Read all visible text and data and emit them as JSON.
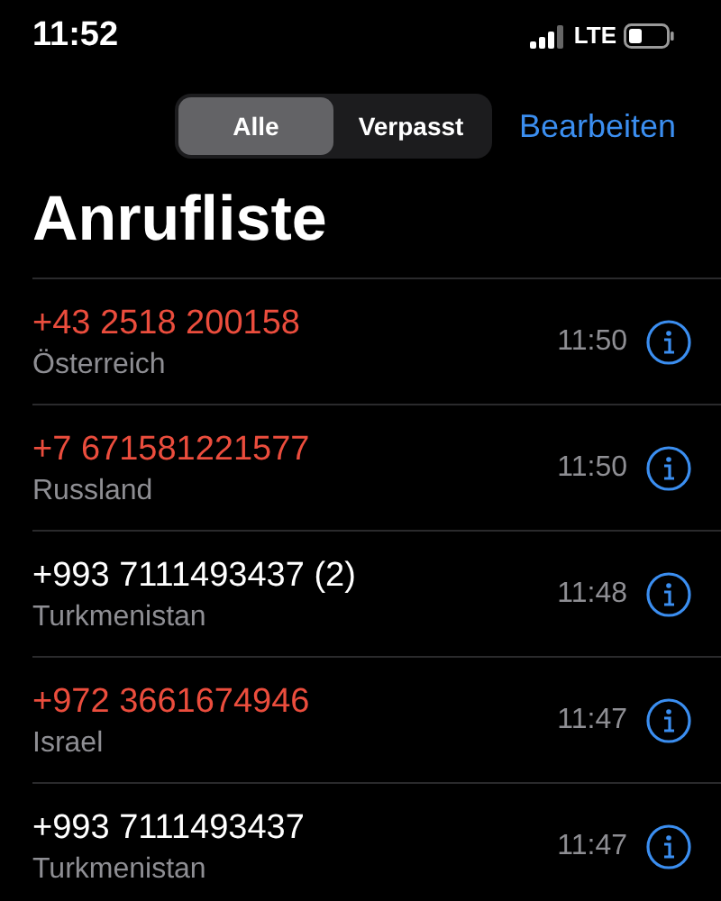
{
  "status_bar": {
    "time": "11:52",
    "network": "LTE"
  },
  "segments": [
    {
      "label": "Alle",
      "selected": true
    },
    {
      "label": "Verpasst",
      "selected": false
    }
  ],
  "edit_button": "Bearbeiten",
  "title": "Anrufliste",
  "calls": [
    {
      "number": "+43 2518 200158",
      "location": "Österreich",
      "time": "11:50",
      "missed": true
    },
    {
      "number": "+7 671581221577",
      "location": "Russland",
      "time": "11:50",
      "missed": true
    },
    {
      "number": "+993 7111493437 (2)",
      "location": "Turkmenistan",
      "time": "11:48",
      "missed": false
    },
    {
      "number": "+972 3661674946",
      "location": "Israel",
      "time": "11:47",
      "missed": true
    },
    {
      "number": "+993 7111493437",
      "location": "Turkmenistan",
      "time": "11:47",
      "missed": false
    }
  ]
}
